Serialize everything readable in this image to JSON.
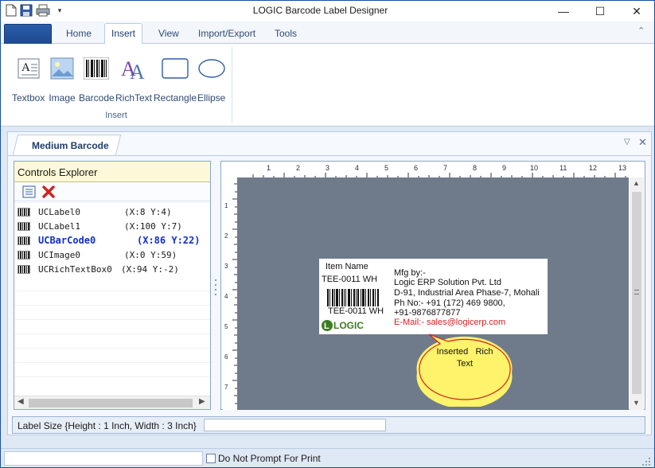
{
  "window": {
    "title": "LOGIC Barcode Label Designer"
  },
  "ribbon": {
    "tabs": [
      {
        "label": "Home"
      },
      {
        "label": "Insert",
        "active": true
      },
      {
        "label": "View"
      },
      {
        "label": "Import/Export"
      },
      {
        "label": "Tools"
      }
    ],
    "buttons": [
      {
        "label": "Textbox",
        "icon": "textbox-icon"
      },
      {
        "label": "Image",
        "icon": "image-icon"
      },
      {
        "label": "Barcode",
        "icon": "barcode-icon"
      },
      {
        "label": "RichText",
        "icon": "richtext-icon"
      },
      {
        "label": "Rectangle",
        "icon": "rectangle-icon"
      },
      {
        "label": "Ellipse",
        "icon": "ellipse-icon"
      }
    ],
    "group_label": "Insert"
  },
  "document_tab": {
    "label": "Medium Barcode"
  },
  "explorer": {
    "title": "Controls Explorer",
    "items": [
      {
        "name": "UCLabel0",
        "coords": "(X:8 Y:4)"
      },
      {
        "name": "UCLabel1",
        "coords": "(X:100 Y:7)"
      },
      {
        "name": "UCBarCode0",
        "coords": "(X:86 Y:22)",
        "selected": true
      },
      {
        "name": "UCImage0",
        "coords": "(X:0 Y:59)"
      },
      {
        "name": "UCRichTextBox0",
        "coords": "(X:94 Y:-2)"
      }
    ]
  },
  "ruler": {
    "top_numbers": [
      "1",
      "2",
      "3",
      "4",
      "5",
      "6",
      "7",
      "8",
      "9",
      "10",
      "11",
      "12",
      "13"
    ],
    "left_numbers": [
      "1",
      "2",
      "3",
      "4",
      "5",
      "6",
      "7"
    ]
  },
  "label": {
    "item_name": "Item Name",
    "item_code": "TEE-0011 WH",
    "barcode_text": "TEE-0011 WH",
    "logo_text": "LOGIC",
    "mfg_by": "Mfg by:-",
    "company": "Logic ERP Solution Pvt. Ltd",
    "address": "D-91, Industrial Area Phase-7, Mohali",
    "phone": "Ph No:- +91 (172) 469 9800,",
    "phone2": "+91-9876877877",
    "email": "E-Mail:- sales@logicerp.com"
  },
  "callout": {
    "line1": "Inserted   Rich",
    "line2": "Text"
  },
  "size_bar": {
    "text": "Label Size {Height : 1 Inch, Width : 3 Inch}"
  },
  "status": {
    "checkbox_label": "Do Not Prompt For Print",
    "checked": false
  },
  "colors": {
    "accent": "#1d4f9c",
    "selected_item": "#1030c8",
    "email_red": "#d42020",
    "logo_green": "#3b7d23",
    "callout_fill": "#fff36b"
  }
}
